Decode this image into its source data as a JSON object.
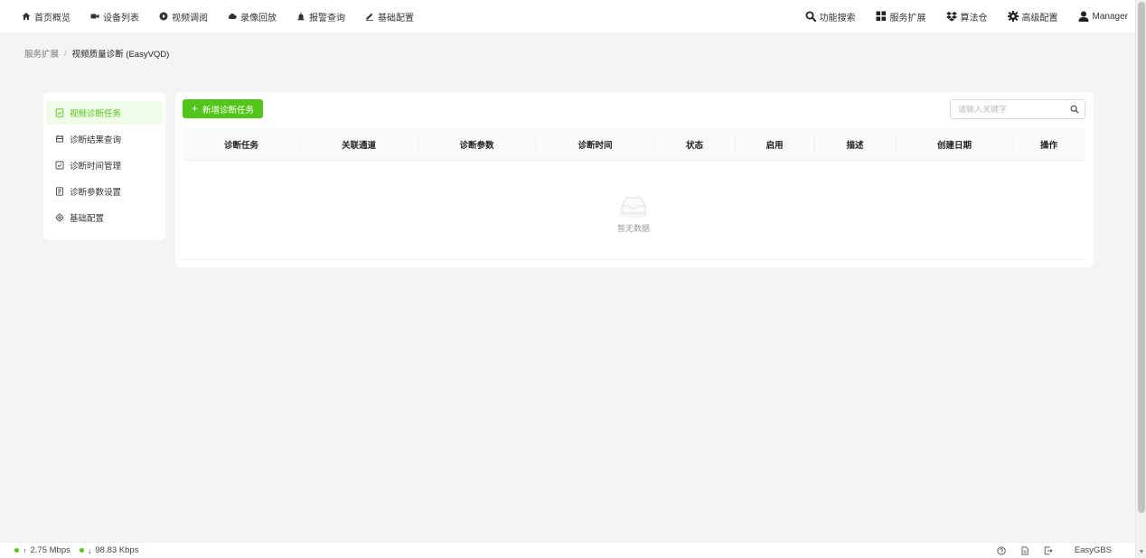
{
  "nav": {
    "left": [
      {
        "label": "首页概览",
        "icon": "home-icon"
      },
      {
        "label": "设备列表",
        "icon": "camera-icon"
      },
      {
        "label": "视频调阅",
        "icon": "play-circle-icon"
      },
      {
        "label": "录像回放",
        "icon": "cloud-icon"
      },
      {
        "label": "报警查询",
        "icon": "alarm-icon"
      },
      {
        "label": "基础配置",
        "icon": "edit-icon"
      }
    ],
    "right": [
      {
        "label": "功能搜索",
        "icon": "search-icon"
      },
      {
        "label": "服务扩展",
        "icon": "grid-icon"
      },
      {
        "label": "算法仓",
        "icon": "dropbox-icon"
      },
      {
        "label": "高级配置",
        "icon": "gear-icon"
      },
      {
        "label": "Manager",
        "icon": "user-icon"
      }
    ]
  },
  "breadcrumb": {
    "parent": "服务扩展",
    "separator": "/",
    "current": "视频质量诊断 (EasyVQD)"
  },
  "side_menu": {
    "items": [
      {
        "label": "视频诊断任务",
        "icon": "task-icon",
        "active": true
      },
      {
        "label": "诊断结果查询",
        "icon": "result-icon",
        "active": false
      },
      {
        "label": "诊断时间管理",
        "icon": "calendar-icon",
        "active": false
      },
      {
        "label": "诊断参数设置",
        "icon": "params-icon",
        "active": false
      },
      {
        "label": "基础配置",
        "icon": "settings-icon",
        "active": false
      }
    ]
  },
  "toolbar": {
    "add_label": "新增诊断任务",
    "search_placeholder": "请输入关键字",
    "search_value": ""
  },
  "table": {
    "columns": [
      "诊断任务",
      "关联通道",
      "诊断参数",
      "诊断时间",
      "状态",
      "启用",
      "描述",
      "创建日期",
      "操作"
    ],
    "rows": [],
    "empty_text": "暂无数据"
  },
  "footer": {
    "upload": "2.75 Mbps",
    "download": "98.83 Kbps",
    "brand": "EasyGBS"
  },
  "colors": {
    "accent": "#52c41a",
    "active_bg": "#f0fbe8",
    "page_bg": "#f4f4f5"
  }
}
